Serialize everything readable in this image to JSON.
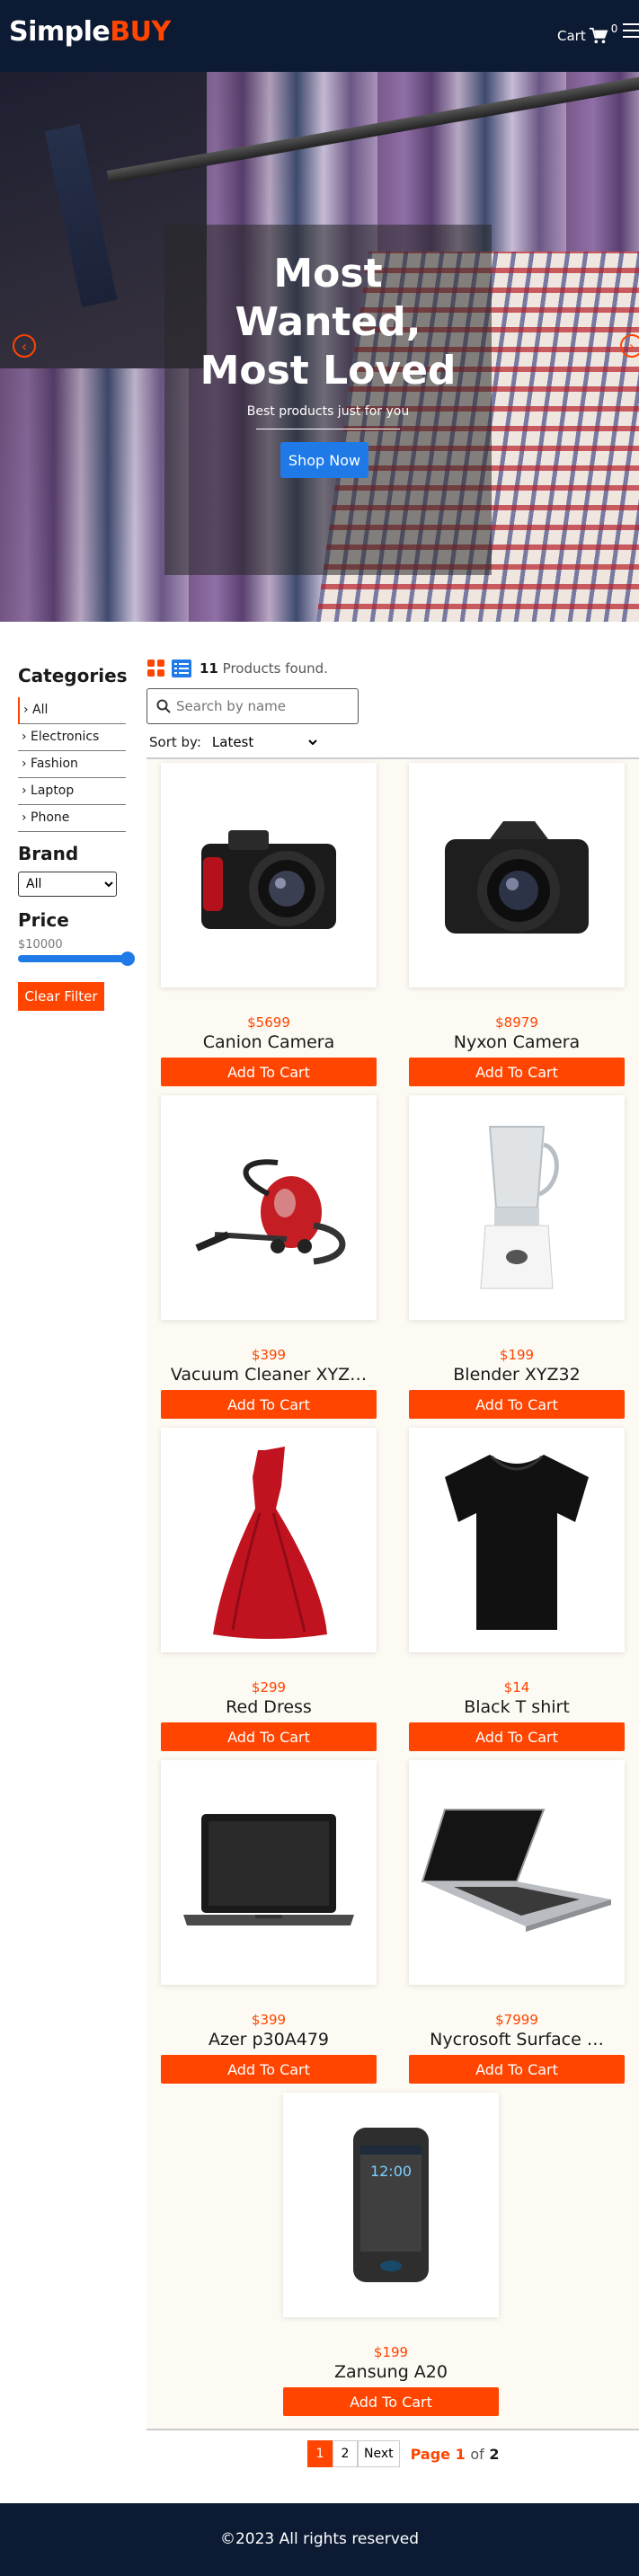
{
  "header": {
    "logo_main": "Simple",
    "logo_accent": "BUY",
    "cart_label": "Cart",
    "cart_count": "0"
  },
  "hero": {
    "title_line1": "Most",
    "title_line2": "Wanted,",
    "title_line3": "Most Loved",
    "subtitle": "Best products just for you",
    "button": "Shop Now"
  },
  "sidebar": {
    "categories_heading": "Categories",
    "categories": [
      "› All",
      "› Electronics",
      "› Fashion",
      "› Laptop",
      "› Phone"
    ],
    "brand_heading": "Brand",
    "brand_selected": "All",
    "price_heading": "Price",
    "price_value": "$10000",
    "price_level": 1.0,
    "clear_button": "Clear Filter"
  },
  "toolbar": {
    "found_count": "11",
    "found_text": "Products found.",
    "search_placeholder": "Search by name",
    "sort_label": "Sort by:",
    "sort_selected": "Latest"
  },
  "products": [
    {
      "price": "$5699",
      "name": "Canion Camera",
      "button": "Add To Cart",
      "icon": "camera"
    },
    {
      "price": "$8979",
      "name": "Nyxon Camera",
      "button": "Add To Cart",
      "icon": "camera"
    },
    {
      "price": "$399",
      "name": "Vacuum Cleaner XYZ…",
      "button": "Add To Cart",
      "icon": "vacuum"
    },
    {
      "price": "$199",
      "name": "Blender XYZ32",
      "button": "Add To Cart",
      "icon": "blender"
    },
    {
      "price": "$299",
      "name": "Red Dress",
      "button": "Add To Cart",
      "icon": "dress"
    },
    {
      "price": "$14",
      "name": "Black T shirt",
      "button": "Add To Cart",
      "icon": "tshirt"
    },
    {
      "price": "$399",
      "name": "Azer p30A479",
      "button": "Add To Cart",
      "icon": "laptop"
    },
    {
      "price": "$7999",
      "name": "Nycrosoft Surface …",
      "button": "Add To Cart",
      "icon": "laptop"
    },
    {
      "price": "$199",
      "name": "Zansung A20",
      "button": "Add To Cart",
      "icon": "phone"
    }
  ],
  "pagination": {
    "pages": [
      "1",
      "2"
    ],
    "next": "Next",
    "page_word": "Page",
    "current": "1",
    "of_word": "of",
    "total": "2"
  },
  "footer": {
    "text": "©2023 All rights reserved"
  },
  "colors": {
    "header_bg": "#0c1b33",
    "accent": "#ff4500",
    "primary_blue": "#1f7ae8"
  }
}
